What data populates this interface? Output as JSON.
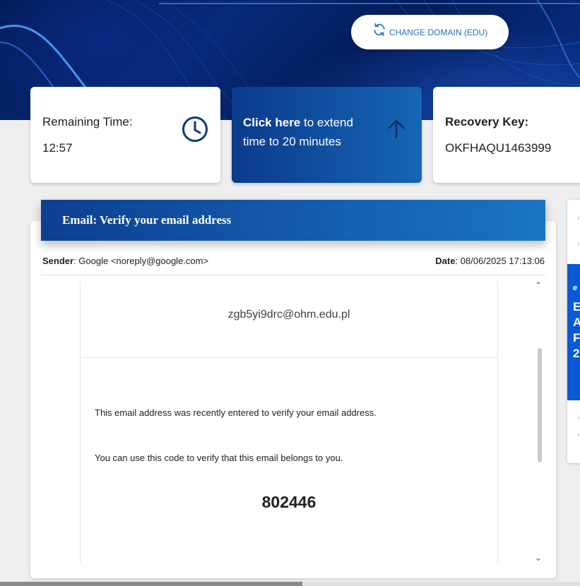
{
  "header": {
    "change_domain_label": "CHANGE DOMAIN (EDU)"
  },
  "cards": {
    "remaining_time_label": "Remaining Time:",
    "remaining_time_value": "12:57",
    "extend_link": "Click here",
    "extend_rest": " to extend time to 20 minutes",
    "recovery_key_label": "Recovery Key:",
    "recovery_key_value": "OKFHAQU1463999"
  },
  "email": {
    "title": "Email: Verify your email address",
    "sender_label": "Sender",
    "sender_value": ": Google <noreply@google.com>",
    "date_label": "Date",
    "date_value": ": 08/06/2025 17:13:06",
    "body": {
      "address": "zgb5yi9drc@ohm.edu.pl",
      "paragraph_1": "This email address was recently entered to verify your email address.",
      "paragraph_2": "You can use this code to verify that this email belongs to you.",
      "code": "802446"
    }
  },
  "side_panel": {
    "ad_text_lines": [
      "E",
      "A",
      "F",
      "2"
    ],
    "ad_prefix": "e"
  },
  "icons": {
    "refresh": "refresh-icon",
    "clock": "clock-icon",
    "arrow_up": "arrow-up-icon",
    "scroll_up": "chevron-up-icon",
    "scroll_down": "chevron-down-icon"
  },
  "colors": {
    "brand_blue": "#0d3f91",
    "accent_blue": "#1a75c4",
    "link_blue": "#2a6fbf",
    "clock_navy": "#0b3a78"
  }
}
